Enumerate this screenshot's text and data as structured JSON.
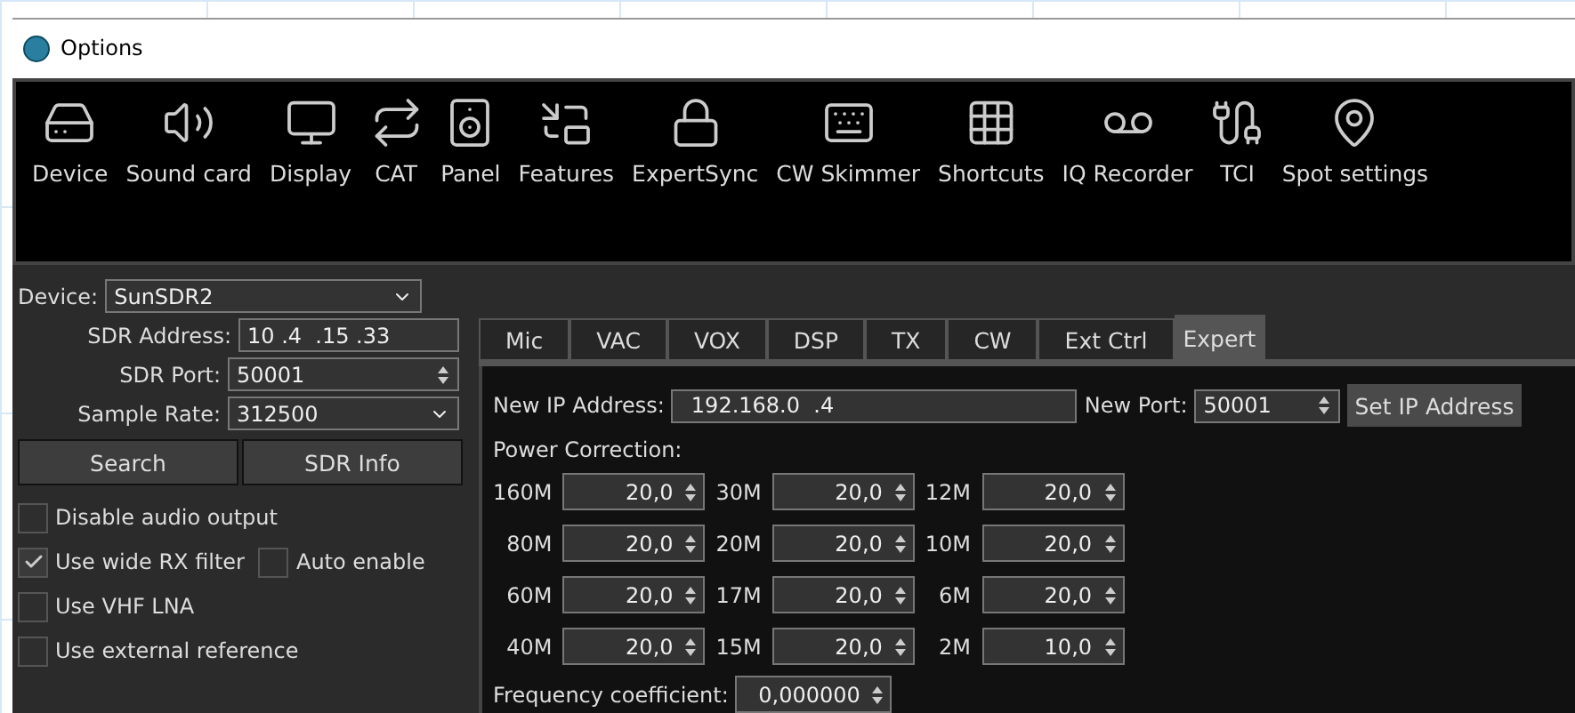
{
  "window": {
    "title": "Options"
  },
  "toolbar": [
    {
      "label": "Device"
    },
    {
      "label": "Sound card"
    },
    {
      "label": "Display"
    },
    {
      "label": "CAT"
    },
    {
      "label": "Panel"
    },
    {
      "label": "Features"
    },
    {
      "label": "ExpertSync"
    },
    {
      "label": "CW Skimmer"
    },
    {
      "label": "Shortcuts"
    },
    {
      "label": "IQ Recorder"
    },
    {
      "label": "TCI"
    },
    {
      "label": "Spot settings"
    }
  ],
  "device": {
    "label": "Device:",
    "value": "SunSDR2"
  },
  "fields": [
    {
      "label": "SDR Address:",
      "value": "10 .4  .15 .33",
      "kind": "text"
    },
    {
      "label": "SDR Port:",
      "value": "50001",
      "kind": "spin"
    },
    {
      "label": "Sample Rate:",
      "value": "312500",
      "kind": "select"
    }
  ],
  "buttons": [
    "Search",
    "SDR Info"
  ],
  "checkbox_rows": [
    [
      {
        "label": "Disable audio output",
        "checked": false
      }
    ],
    [
      {
        "label": "Use wide RX filter",
        "checked": true
      },
      {
        "label": "Auto enable",
        "checked": false
      }
    ],
    [
      {
        "label": "Use VHF LNA",
        "checked": false
      }
    ],
    [
      {
        "label": "Use external reference",
        "checked": false
      }
    ]
  ],
  "tabs": [
    {
      "label": "Mic",
      "selected": false
    },
    {
      "label": "VAC",
      "selected": false
    },
    {
      "label": "VOX",
      "selected": false
    },
    {
      "label": "DSP",
      "selected": false
    },
    {
      "label": "TX",
      "selected": false
    },
    {
      "label": "CW",
      "selected": false
    },
    {
      "label": "Ext Ctrl",
      "selected": false
    },
    {
      "label": "Expert",
      "selected": true
    }
  ],
  "expert": {
    "ip_label": "New IP Address:",
    "ip_value": "192.168.0  .4",
    "port_label": "New Port:",
    "port_value": "50001",
    "set_button": "Set IP Address",
    "power_label": "Power Correction:",
    "bands": [
      [
        {
          "band": "160M",
          "value": "20,0"
        },
        {
          "band": "30M",
          "value": "20,0"
        },
        {
          "band": "12M",
          "value": "20,0"
        }
      ],
      [
        {
          "band": "80M",
          "value": "20,0"
        },
        {
          "band": "20M",
          "value": "20,0"
        },
        {
          "band": "10M",
          "value": "20,0"
        }
      ],
      [
        {
          "band": "60M",
          "value": "20,0"
        },
        {
          "band": "17M",
          "value": "20,0"
        },
        {
          "band": "6M",
          "value": "20,0"
        }
      ],
      [
        {
          "band": "40M",
          "value": "20,0"
        },
        {
          "band": "15M",
          "value": "20,0"
        },
        {
          "band": "2M",
          "value": "10,0"
        }
      ]
    ],
    "freq_label": "Frequency coefficient:",
    "freq_value": "0,000000"
  }
}
